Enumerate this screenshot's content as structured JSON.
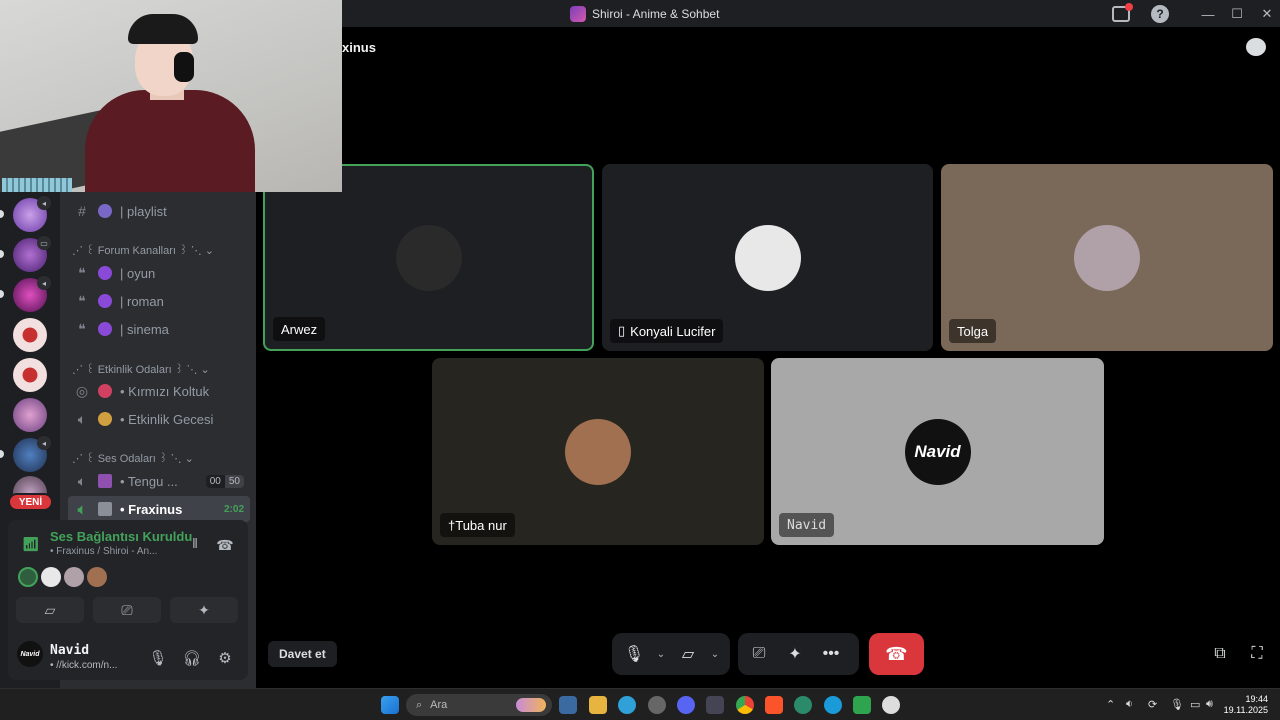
{
  "window": {
    "title": "Shiroi - Anime & Sohbet"
  },
  "channels": {
    "playlist": "| playlist",
    "forum_category": "⋰ ꒰ Forum Kanalları ꒱ ⋱",
    "oyun": "| oyun",
    "roman": "| roman",
    "sinema": "| sinema",
    "event_category": "⋰ ꒰ Etkinlik Odaları ꒱ ⋱",
    "kirmizi": "• Kırmızı Koltuk",
    "etkinlik": "• Etkinlik Gecesi",
    "voice_category": "⋰ ꒰ Ses Odaları ꒱ ⋱",
    "tengu": "• Tengu ...",
    "tengu_count": "00",
    "tengu_limit": "50",
    "fraxinus": "• Fraxinus",
    "fraxinus_time": "2:02"
  },
  "rail": {
    "new_badge": "YENİ"
  },
  "voice_panel": {
    "status": "Ses Bağlantısı Kuruldu",
    "location": "• Fraxinus / Shiroi - An..."
  },
  "user": {
    "name": "Navid",
    "status": "• //kick.com/n...",
    "avatar_text": "Navid"
  },
  "stage": {
    "channel_title": "xinus",
    "tiles": [
      {
        "name": "Arwez",
        "color": "#1e1f22",
        "avatar": "#2a2a2a"
      },
      {
        "name": "Konyali Lucifer",
        "color": "#1e1f22",
        "avatar": "#e8e8e8"
      },
      {
        "name": "Tolga",
        "color": "#7a6858",
        "avatar": "#b0a0a8"
      },
      {
        "name": "†Tuba nur",
        "color": "#27251f",
        "avatar": "#a07050"
      },
      {
        "name": "Navid",
        "color": "#a8a8a8",
        "avatar": "#111111"
      }
    ],
    "navid_logo": "Navid"
  },
  "controls": {
    "invite": "Davet et"
  },
  "taskbar": {
    "search_placeholder": "Ara",
    "time": "19:44",
    "date": "19.11.2025"
  },
  "colors": {
    "accent_green": "#43a25a",
    "danger": "#da373c",
    "panel": "#2b2d31",
    "rail": "#1e1f22"
  }
}
